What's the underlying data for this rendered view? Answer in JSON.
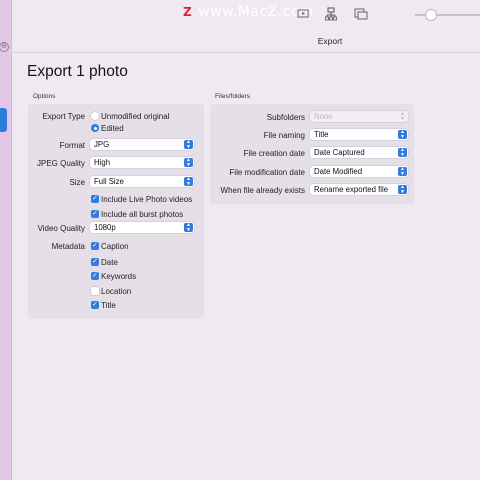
{
  "window": {
    "title": "Export"
  },
  "watermark": {
    "logo": "Z",
    "text": "www.MacZ.com"
  },
  "toolbar": {
    "icons": [
      "slideshow-icon",
      "people-icon",
      "share-icon"
    ]
  },
  "page": {
    "title": "Export 1 photo"
  },
  "options": {
    "section_label": "Options",
    "export_type": {
      "label": "Export Type",
      "choices": [
        "Unmodified original",
        "Edited"
      ],
      "selected": "Edited"
    },
    "format": {
      "label": "Format",
      "value": "JPG"
    },
    "jpeg_quality": {
      "label": "JPEG Quality",
      "value": "High"
    },
    "size": {
      "label": "Size",
      "value": "Full Size"
    },
    "include_live": {
      "label": "Include Live Photo videos",
      "checked": true
    },
    "include_burst": {
      "label": "Include all burst photos",
      "checked": true
    },
    "video_quality": {
      "label": "Video Quality",
      "value": "1080p"
    },
    "metadata": {
      "label": "Metadata",
      "items": [
        {
          "label": "Caption",
          "checked": true
        },
        {
          "label": "Date",
          "checked": true
        },
        {
          "label": "Keywords",
          "checked": true
        },
        {
          "label": "Location",
          "checked": false
        },
        {
          "label": "Title",
          "checked": true
        }
      ]
    }
  },
  "files": {
    "section_label": "Files/folders",
    "subfolders": {
      "label": "Subfolders",
      "value": "None",
      "disabled": true
    },
    "file_naming": {
      "label": "File naming",
      "value": "Title"
    },
    "creation_date": {
      "label": "File creation date",
      "value": "Date Captured"
    },
    "modification_date": {
      "label": "File modification date",
      "value": "Date Modified"
    },
    "exists": {
      "label": "When file already exists",
      "value": "Rename exported file"
    }
  },
  "colors": {
    "accent": "#2f7de1",
    "background": "#efe9f2",
    "sidebar": "#e2c8e6"
  }
}
